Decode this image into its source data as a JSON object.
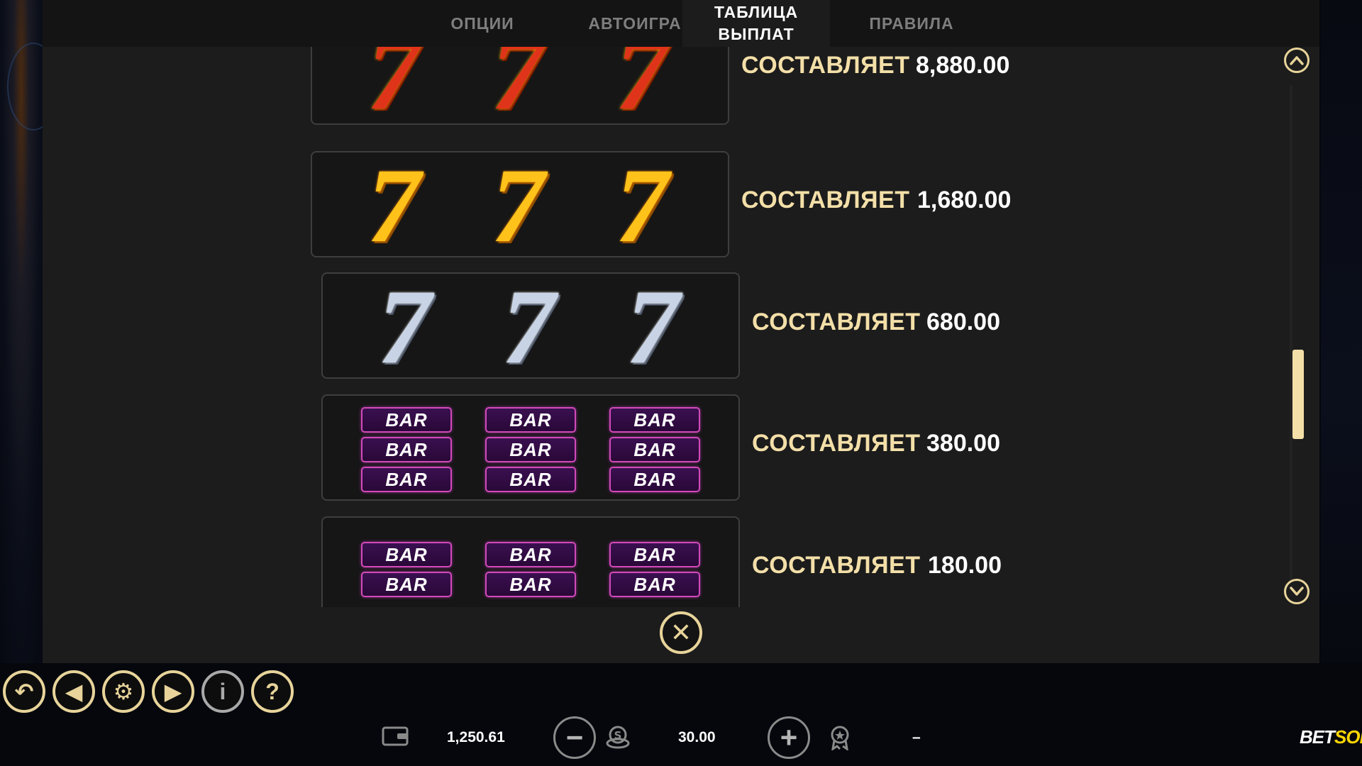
{
  "tabs": [
    {
      "label": "ОПЦИИ"
    },
    {
      "label": "АВТОИГРА"
    },
    {
      "label": "ТАБЛИЦА\nВЫПЛАТ"
    },
    {
      "label": "ПРАВИЛА"
    }
  ],
  "paytable": {
    "rows": [
      {
        "symbol": "fire-seven",
        "glyph": "7",
        "label": "СОСТАВЛЯЕТ",
        "value": "8,880.00"
      },
      {
        "symbol": "gold-seven",
        "glyph": "7",
        "label": "СОСТАВЛЯЕТ",
        "value": "1,680.00"
      },
      {
        "symbol": "silver-seven",
        "glyph": "7",
        "label": "СОСТАВЛЯЕТ",
        "value": "680.00"
      },
      {
        "symbol": "triple-bar",
        "glyph": "BAR",
        "label": "СОСТАВЛЯЕТ",
        "value": "380.00"
      },
      {
        "symbol": "double-bar",
        "glyph": "BAR",
        "label": "СОСТАВЛЯЕТ",
        "value": "180.00"
      }
    ]
  },
  "scroll": {
    "up_icon": "chevron-up-icon",
    "down_icon": "chevron-down-icon",
    "position": 0.65
  },
  "close": {
    "icon": "close-icon",
    "glyph": "✕"
  },
  "controls": {
    "back": "↶",
    "sound": "◀",
    "settings": "⚙",
    "autoplay": "▶",
    "info": "i",
    "help": "?"
  },
  "bottom": {
    "balance": "1,250.61",
    "minus": "−",
    "bet": "30.00",
    "plus": "+",
    "win": "–"
  },
  "brand": {
    "part1": "BET",
    "part2": "SOFT"
  },
  "colors": {
    "accent": "#e8d49a",
    "label": "#f3dfa8",
    "panel": "#1c1c1c"
  }
}
